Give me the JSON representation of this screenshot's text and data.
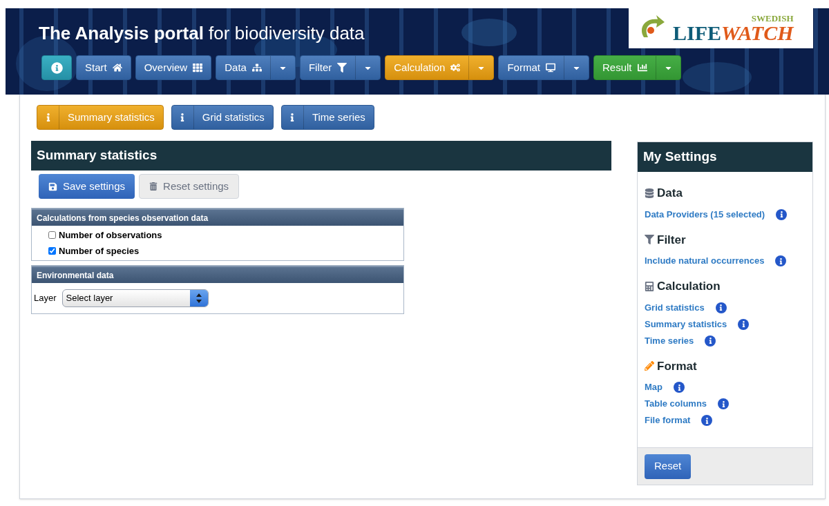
{
  "header": {
    "title_bold": "The Analysis portal",
    "title_rest": "for biodiversity data",
    "logo": {
      "top": "SWEDISH",
      "left": "LIFE",
      "right": "WATCH"
    }
  },
  "nav": [
    {
      "kind": "info",
      "selected": false
    },
    {
      "kind": "step",
      "label": "Start",
      "dropdown": false,
      "selected": false
    },
    {
      "kind": "step",
      "label": "Overview",
      "dropdown": false,
      "selected": false
    },
    {
      "kind": "step",
      "label": "Data",
      "dropdown": true,
      "selected": false
    },
    {
      "kind": "step",
      "label": "Filter",
      "dropdown": true,
      "selected": false
    },
    {
      "kind": "step",
      "label": "Calculation",
      "dropdown": true,
      "selected": true
    },
    {
      "kind": "step",
      "label": "Format",
      "dropdown": true,
      "selected": false
    },
    {
      "kind": "result",
      "label": "Result",
      "dropdown": true,
      "selected": false
    }
  ],
  "subtabs": [
    {
      "label": "Summary statistics",
      "selected": true
    },
    {
      "label": "Grid statistics",
      "selected": false
    },
    {
      "label": "Time series",
      "selected": false
    }
  ],
  "main": {
    "title": "Summary statistics",
    "save_button": "Save settings",
    "reset_button": "Reset settings",
    "groups": [
      {
        "title": "Calculations from species observation data",
        "kind": "checks",
        "options": [
          {
            "label": "Number of observations",
            "checked": false
          },
          {
            "label": "Number of species",
            "checked": true
          }
        ]
      },
      {
        "title": "Environmental data",
        "kind": "select",
        "label": "Layer",
        "value": "Select layer"
      }
    ]
  },
  "settings": {
    "title": "My Settings",
    "sections": [
      {
        "title": "Data",
        "links": [
          "Data Providers (15 selected)"
        ]
      },
      {
        "title": "Filter",
        "links": [
          "Include natural occurrences"
        ]
      },
      {
        "title": "Calculation",
        "links": [
          "Grid statistics",
          "Summary statistics",
          "Time series"
        ]
      },
      {
        "title": "Format",
        "links": [
          "Map",
          "Table columns",
          "File format"
        ]
      }
    ],
    "reset_button": "Reset"
  }
}
